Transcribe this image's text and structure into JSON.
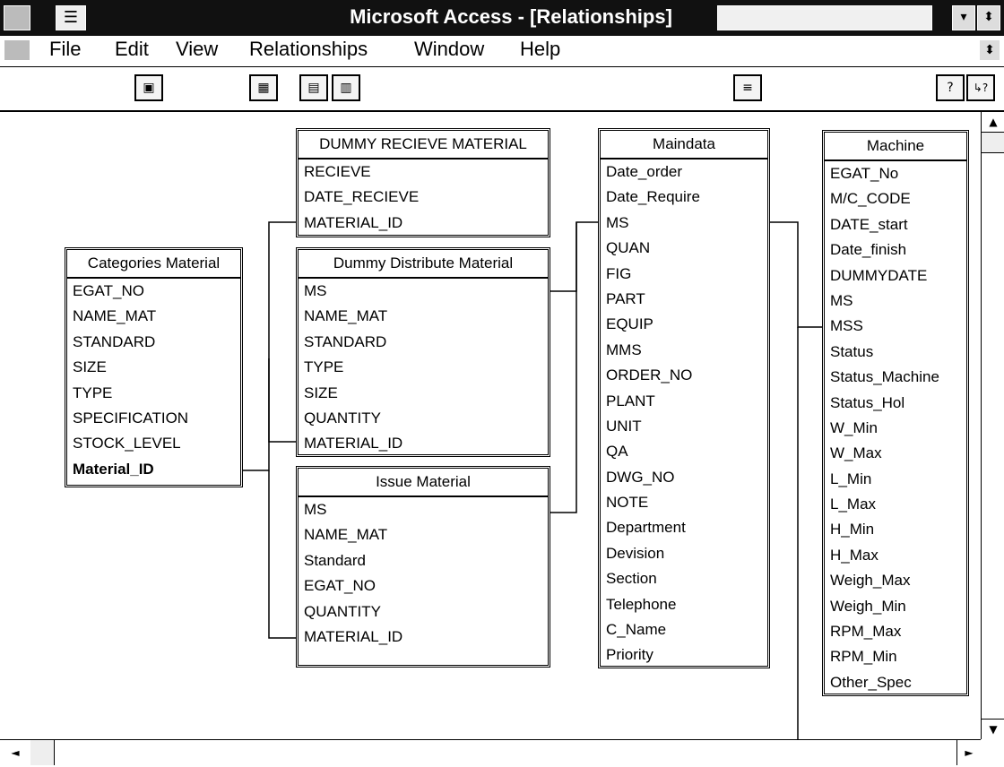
{
  "window": {
    "title": "Microsoft Access - [Relationships]"
  },
  "menu": [
    "File",
    "Edit",
    "View",
    "Relationships",
    "Window",
    "Help"
  ],
  "toolbar": {
    "buttons": [
      {
        "name": "save-button",
        "glyph": "▣"
      },
      {
        "name": "add-table-button",
        "glyph": "▦"
      },
      {
        "name": "show-direct-button",
        "glyph": "▤"
      },
      {
        "name": "show-all-button",
        "glyph": "▥"
      },
      {
        "name": "database-window-button",
        "glyph": "≡"
      },
      {
        "name": "help-button",
        "glyph": "?"
      },
      {
        "name": "context-help-button",
        "glyph": "↳?"
      }
    ]
  },
  "tables": {
    "dummy_recieve": {
      "title": "DUMMY RECIEVE MATERIAL",
      "fields": [
        "RECIEVE",
        "DATE_RECIEVE",
        "MATERIAL_ID"
      ]
    },
    "categories": {
      "title": "Categories Material",
      "fields": [
        "EGAT_NO",
        "NAME_MAT",
        "STANDARD",
        "SIZE",
        "TYPE",
        "SPECIFICATION",
        "STOCK_LEVEL",
        "Material_ID"
      ]
    },
    "dummy_distribute": {
      "title": "Dummy Distribute Material",
      "fields": [
        "MS",
        "NAME_MAT",
        "STANDARD",
        "TYPE",
        "SIZE",
        "QUANTITY",
        "MATERIAL_ID"
      ]
    },
    "issue": {
      "title": "Issue Material",
      "fields": [
        "MS",
        "NAME_MAT",
        "Standard",
        "EGAT_NO",
        "QUANTITY",
        "MATERIAL_ID"
      ]
    },
    "maindata": {
      "title": "Maindata",
      "fields": [
        "Date_order",
        "Date_Require",
        "MS",
        "QUAN",
        "FIG",
        "PART",
        "EQUIP",
        "MMS",
        "ORDER_NO",
        "PLANT",
        "UNIT",
        "QA",
        "DWG_NO",
        "NOTE",
        "Department",
        "Devision",
        "Section",
        "Telephone",
        "C_Name",
        "Priority"
      ]
    },
    "machine": {
      "title": "Machine",
      "fields": [
        "EGAT_No",
        "M/C_CODE",
        "DATE_start",
        "Date_finish",
        "DUMMYDATE",
        "MS",
        "MSS",
        "Status",
        "Status_Machine",
        "Status_Hol",
        "W_Min",
        "W_Max",
        "L_Min",
        "L_Max",
        "H_Min",
        "H_Max",
        "Weigh_Max",
        "Weigh_Min",
        "RPM_Max",
        "RPM_Min",
        "Other_Spec"
      ]
    }
  }
}
